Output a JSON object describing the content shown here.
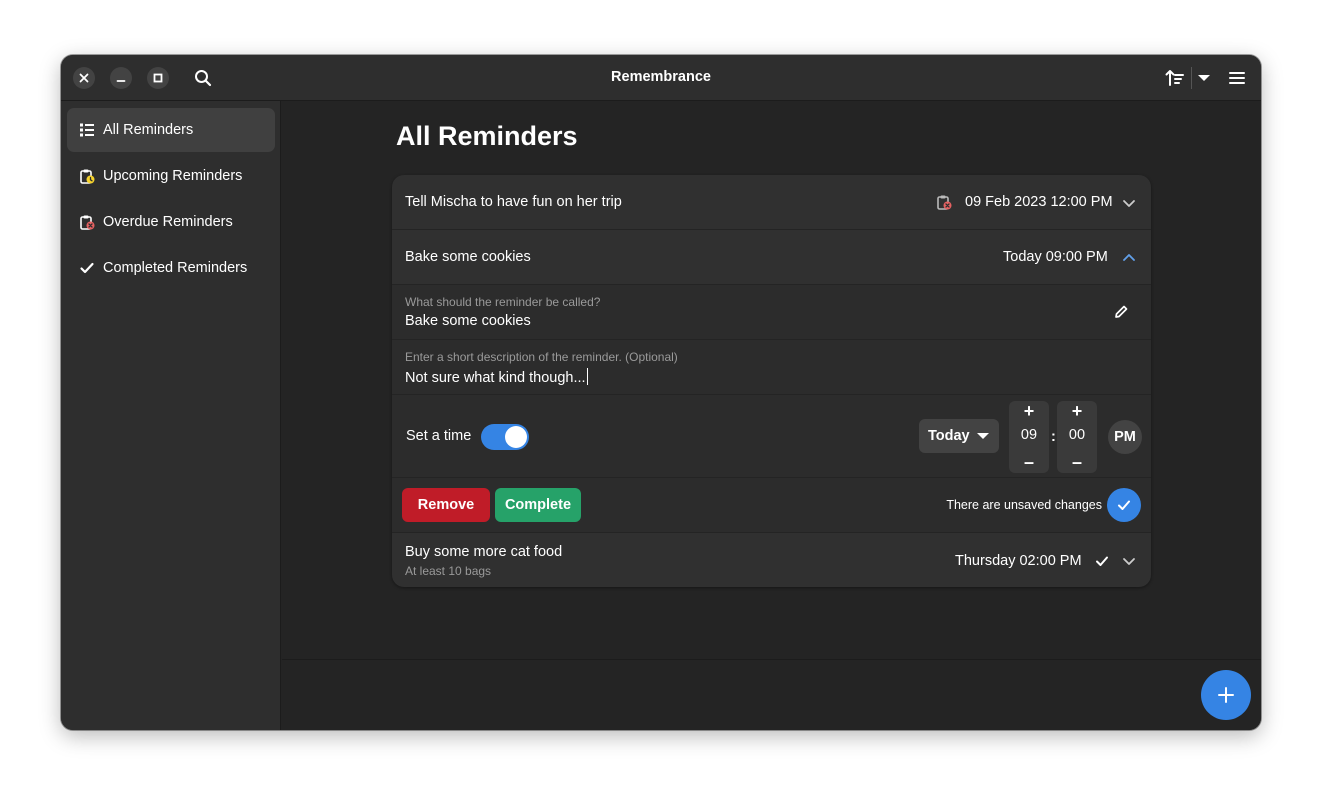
{
  "window": {
    "title": "Remembrance"
  },
  "headerbar": {
    "close_icon": "close-icon",
    "minimize_icon": "minimize-icon",
    "maximize_icon": "maximize-icon",
    "search_icon": "search-icon",
    "sort_icon": "sort-ascending-icon",
    "sort_menu_icon": "pan-down-icon",
    "main_menu_icon": "hamburger-menu-icon"
  },
  "sidebar": {
    "items": [
      {
        "label": "All Reminders",
        "icon": "list-icon",
        "active": true
      },
      {
        "label": "Upcoming Reminders",
        "icon": "clipboard-upcoming-icon",
        "active": false
      },
      {
        "label": "Overdue Reminders",
        "icon": "clipboard-overdue-icon",
        "active": false
      },
      {
        "label": "Completed Reminders",
        "icon": "checkmark-icon",
        "active": false
      }
    ]
  },
  "main": {
    "title": "All Reminders",
    "reminders": [
      {
        "title": "Tell Mischa to have fun on her trip",
        "date": "09 Feb 2023 12:00 PM",
        "status_icon": "clipboard-overdue-icon",
        "expanded": false
      },
      {
        "title": "Bake some cookies",
        "date": "Today 09:00 PM",
        "expanded": true,
        "editor": {
          "title_label": "What should the reminder be called?",
          "title_value": "Bake some cookies",
          "description_label": "Enter a short description of the reminder. (Optional)",
          "description_value": "Not sure what kind though...",
          "set_time_label": "Set a time",
          "set_time_enabled": true,
          "day_value": "Today",
          "hour_value": "09",
          "minute_value": "00",
          "time_separator": ":",
          "ampm_value": "PM",
          "increment_symbol": "+",
          "decrement_symbol": "–",
          "remove_label": "Remove",
          "complete_label": "Complete",
          "unsaved_text": "There are unsaved changes"
        }
      },
      {
        "title": "Buy some more cat food",
        "subtitle": "At least 10 bags",
        "date": "Thursday 02:00 PM",
        "status_icon": "checkmark-icon",
        "expanded": false
      }
    ]
  },
  "colors": {
    "accent": "#3584e4",
    "destructive": "#c01c28",
    "success": "#26a269",
    "window_bg": "#242424",
    "sidebar_bg": "#2e2e2e",
    "card_bg": "#303030",
    "overdue_red": "#e66161"
  },
  "fab": {
    "icon": "add-icon"
  }
}
